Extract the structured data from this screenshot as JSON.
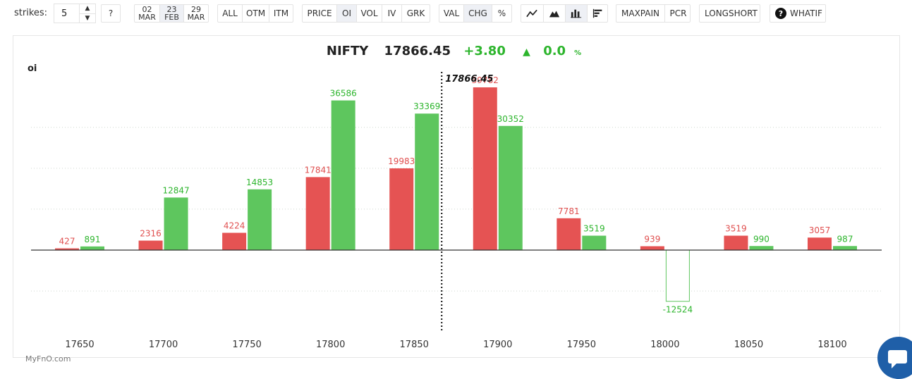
{
  "toolbar": {
    "strikes_label": "strikes:",
    "strikes_value": "5",
    "help": "?",
    "dates": [
      {
        "d": "02",
        "m": "MAR"
      },
      {
        "d": "23",
        "m": "FEB"
      },
      {
        "d": "29",
        "m": "MAR"
      }
    ],
    "filters": [
      "ALL",
      "OTM",
      "ITM"
    ],
    "metrics": [
      "PRICE",
      "OI",
      "VOL",
      "IV",
      "GRK"
    ],
    "modes": [
      "VAL",
      "CHG",
      "%"
    ],
    "maxpain": "MAXPAIN",
    "pcr": "PCR",
    "longshort": "LONGSHORT",
    "whatif": "WHATIF"
  },
  "header": {
    "symbol": "NIFTY",
    "price": "17866.45",
    "change": "+3.80",
    "pct": "0.0",
    "pct_unit": "%"
  },
  "brand": "MyFnO.com",
  "colors": {
    "put": "#e55353",
    "call": "#5ec65e",
    "call_text": "#2db52d",
    "put_text": "#e05050"
  },
  "chart_data": {
    "type": "bar",
    "ylabel": "oi",
    "categories": [
      "17650",
      "17700",
      "17750",
      "17800",
      "17850",
      "17900",
      "17950",
      "18000",
      "18050",
      "18100"
    ],
    "series": [
      {
        "values": [
          427,
          2316,
          4224,
          17841,
          19983,
          39782,
          7781,
          939,
          3519,
          3057
        ]
      },
      {
        "values": [
          891,
          12847,
          14853,
          36586,
          33369,
          30352,
          3519,
          -12524,
          990,
          987
        ]
      }
    ],
    "value_labels": [
      [
        "427",
        "2316",
        "4224",
        "17841",
        "19983",
        "39782",
        "7781",
        "939",
        "3519",
        "3057"
      ],
      [
        "891",
        "12847",
        "14853",
        "36586",
        "33369",
        "30352",
        "3519",
        "-12524",
        "990",
        "987"
      ]
    ],
    "spot_label": "17866.45",
    "spot_value": 17866.45,
    "ylim": [
      -15000,
      40000
    ]
  }
}
